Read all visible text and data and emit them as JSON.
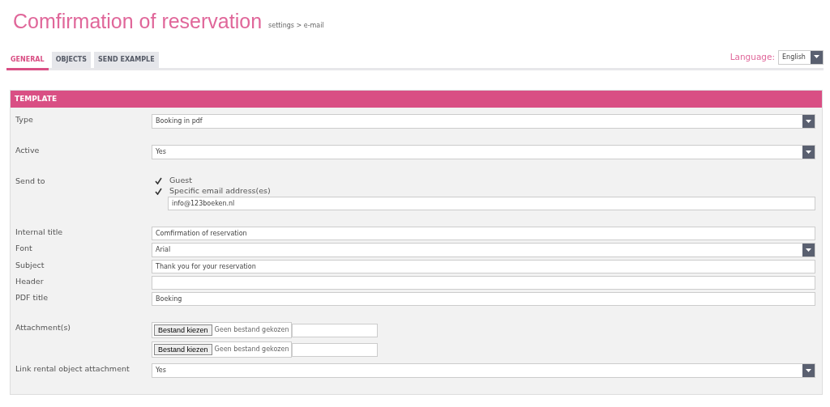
{
  "title": "Comfirmation of reservation",
  "breadcrumb": "settings > e-mail",
  "tabs": [
    {
      "label": "GENERAL",
      "selected": true
    },
    {
      "label": "OBJECTS",
      "selected": false
    },
    {
      "label": "SEND EXAMPLE",
      "selected": false
    }
  ],
  "language": {
    "label": "Language:",
    "value": "English"
  },
  "panel": {
    "title": "TEMPLATE",
    "groups": [
      [
        {
          "kind": "select",
          "label": "Type",
          "value": "Booking in pdf"
        }
      ],
      [
        {
          "kind": "select",
          "label": "Active",
          "value": "Yes"
        }
      ],
      [
        {
          "kind": "checks",
          "label": "Send to",
          "options": [
            {
              "label": "Guest",
              "checked": true
            },
            {
              "label": "Specific email address(es)",
              "checked": true
            }
          ],
          "value": "info@123boeken.nl"
        }
      ],
      [
        {
          "kind": "text",
          "label": "Internal title",
          "value": "Comfirmation of reservation"
        },
        {
          "kind": "select",
          "label": "Font",
          "value": "Arial"
        },
        {
          "kind": "text",
          "label": "Subject",
          "value": "Thank you for your reservation"
        },
        {
          "kind": "text",
          "label": "Header"
        },
        {
          "kind": "text",
          "label": "PDF title",
          "value": "Boeking"
        }
      ],
      [
        {
          "kind": "files",
          "label": "Attachment(s)",
          "files": [
            {
              "button": "Bestand kiezen",
              "status": "Geen bestand gekozen"
            },
            {
              "button": "Bestand kiezen",
              "status": "Geen bestand gekozen"
            }
          ]
        },
        {
          "kind": "select",
          "label": "Link rental object attachment",
          "value": "Yes"
        }
      ]
    ]
  }
}
